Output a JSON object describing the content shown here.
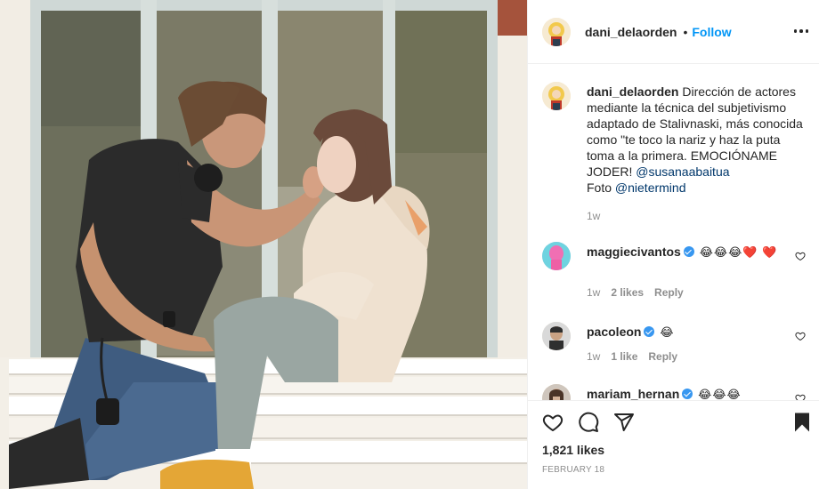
{
  "photo": {
    "alt": "two people sitting on a white bench in front of glass doors"
  },
  "header": {
    "username": "dani_delaorden",
    "dot": "•",
    "follow_label": "Follow"
  },
  "caption": {
    "username": "dani_delaorden",
    "text": "Dirección de actores mediante la técnica del subjetivismo adaptado de Stalivnaski, más conocida como \"te toco la nariz y haz la puta toma a la primera. EMOCIÓNAME JODER!",
    "mention1": "@susanaabaitua",
    "photo_prefix": "Foto",
    "mention2": "@nietermind",
    "time": "1w"
  },
  "comments": [
    {
      "username": "maggiecivantos",
      "emoji": "😂😂😂❤️ ❤️",
      "time": "1w",
      "likes": "2 likes",
      "reply": "Reply"
    },
    {
      "username": "pacoleon",
      "emoji": "😂",
      "time": "1w",
      "likes": "1 like",
      "reply": "Reply"
    },
    {
      "username": "mariam_hernan",
      "emoji": "😂😂😂"
    }
  ],
  "footer": {
    "likes": "1,821 likes",
    "date": "FEBRUARY 18"
  },
  "icons": {
    "like": "heart-outline",
    "comment": "speech-bubble",
    "share": "paper-plane",
    "save": "bookmark-filled",
    "more": "three-dots"
  },
  "colors": {
    "link_blue": "#0095f6",
    "mention_blue": "#00376b",
    "verified_blue": "#3897f0",
    "secondary_text": "#8e8e8e",
    "primary_text": "#262626"
  }
}
